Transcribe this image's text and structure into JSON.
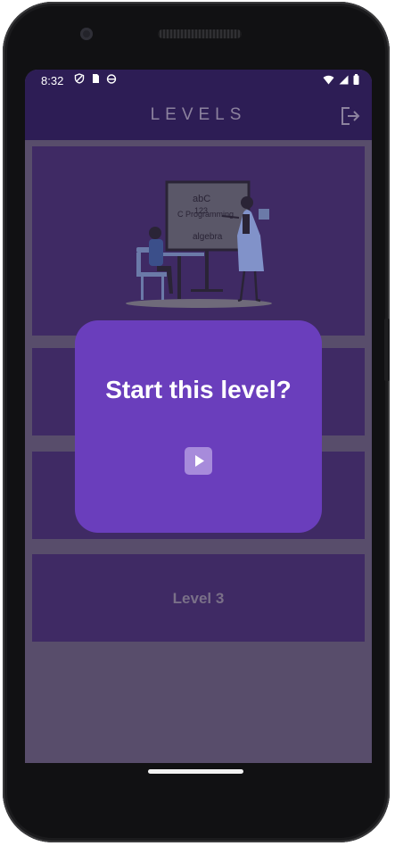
{
  "status_bar": {
    "time": "8:32",
    "left_icons": [
      "shield-icon",
      "sim-card-icon",
      "android-icon"
    ],
    "right_icons": [
      "wifi-icon",
      "cell-signal-icon",
      "battery-icon"
    ]
  },
  "app_bar": {
    "title": "LEVELS",
    "logout_icon": "logout-icon"
  },
  "levels": {
    "cards": [
      {
        "label": "",
        "illustration": "teacher-classroom-illustration"
      },
      {
        "label": ""
      },
      {
        "label": ""
      },
      {
        "label": "Level 3"
      }
    ]
  },
  "dialog": {
    "title": "Start this level?",
    "play_icon": "play-icon"
  },
  "colors": {
    "app_bar_bg": "#2d1d55",
    "card_bg": "#3f2a64",
    "dialog_bg": "#6a3ebc",
    "play_button_bg": "#a78bdb",
    "scrim_bg": "#584d6b"
  }
}
